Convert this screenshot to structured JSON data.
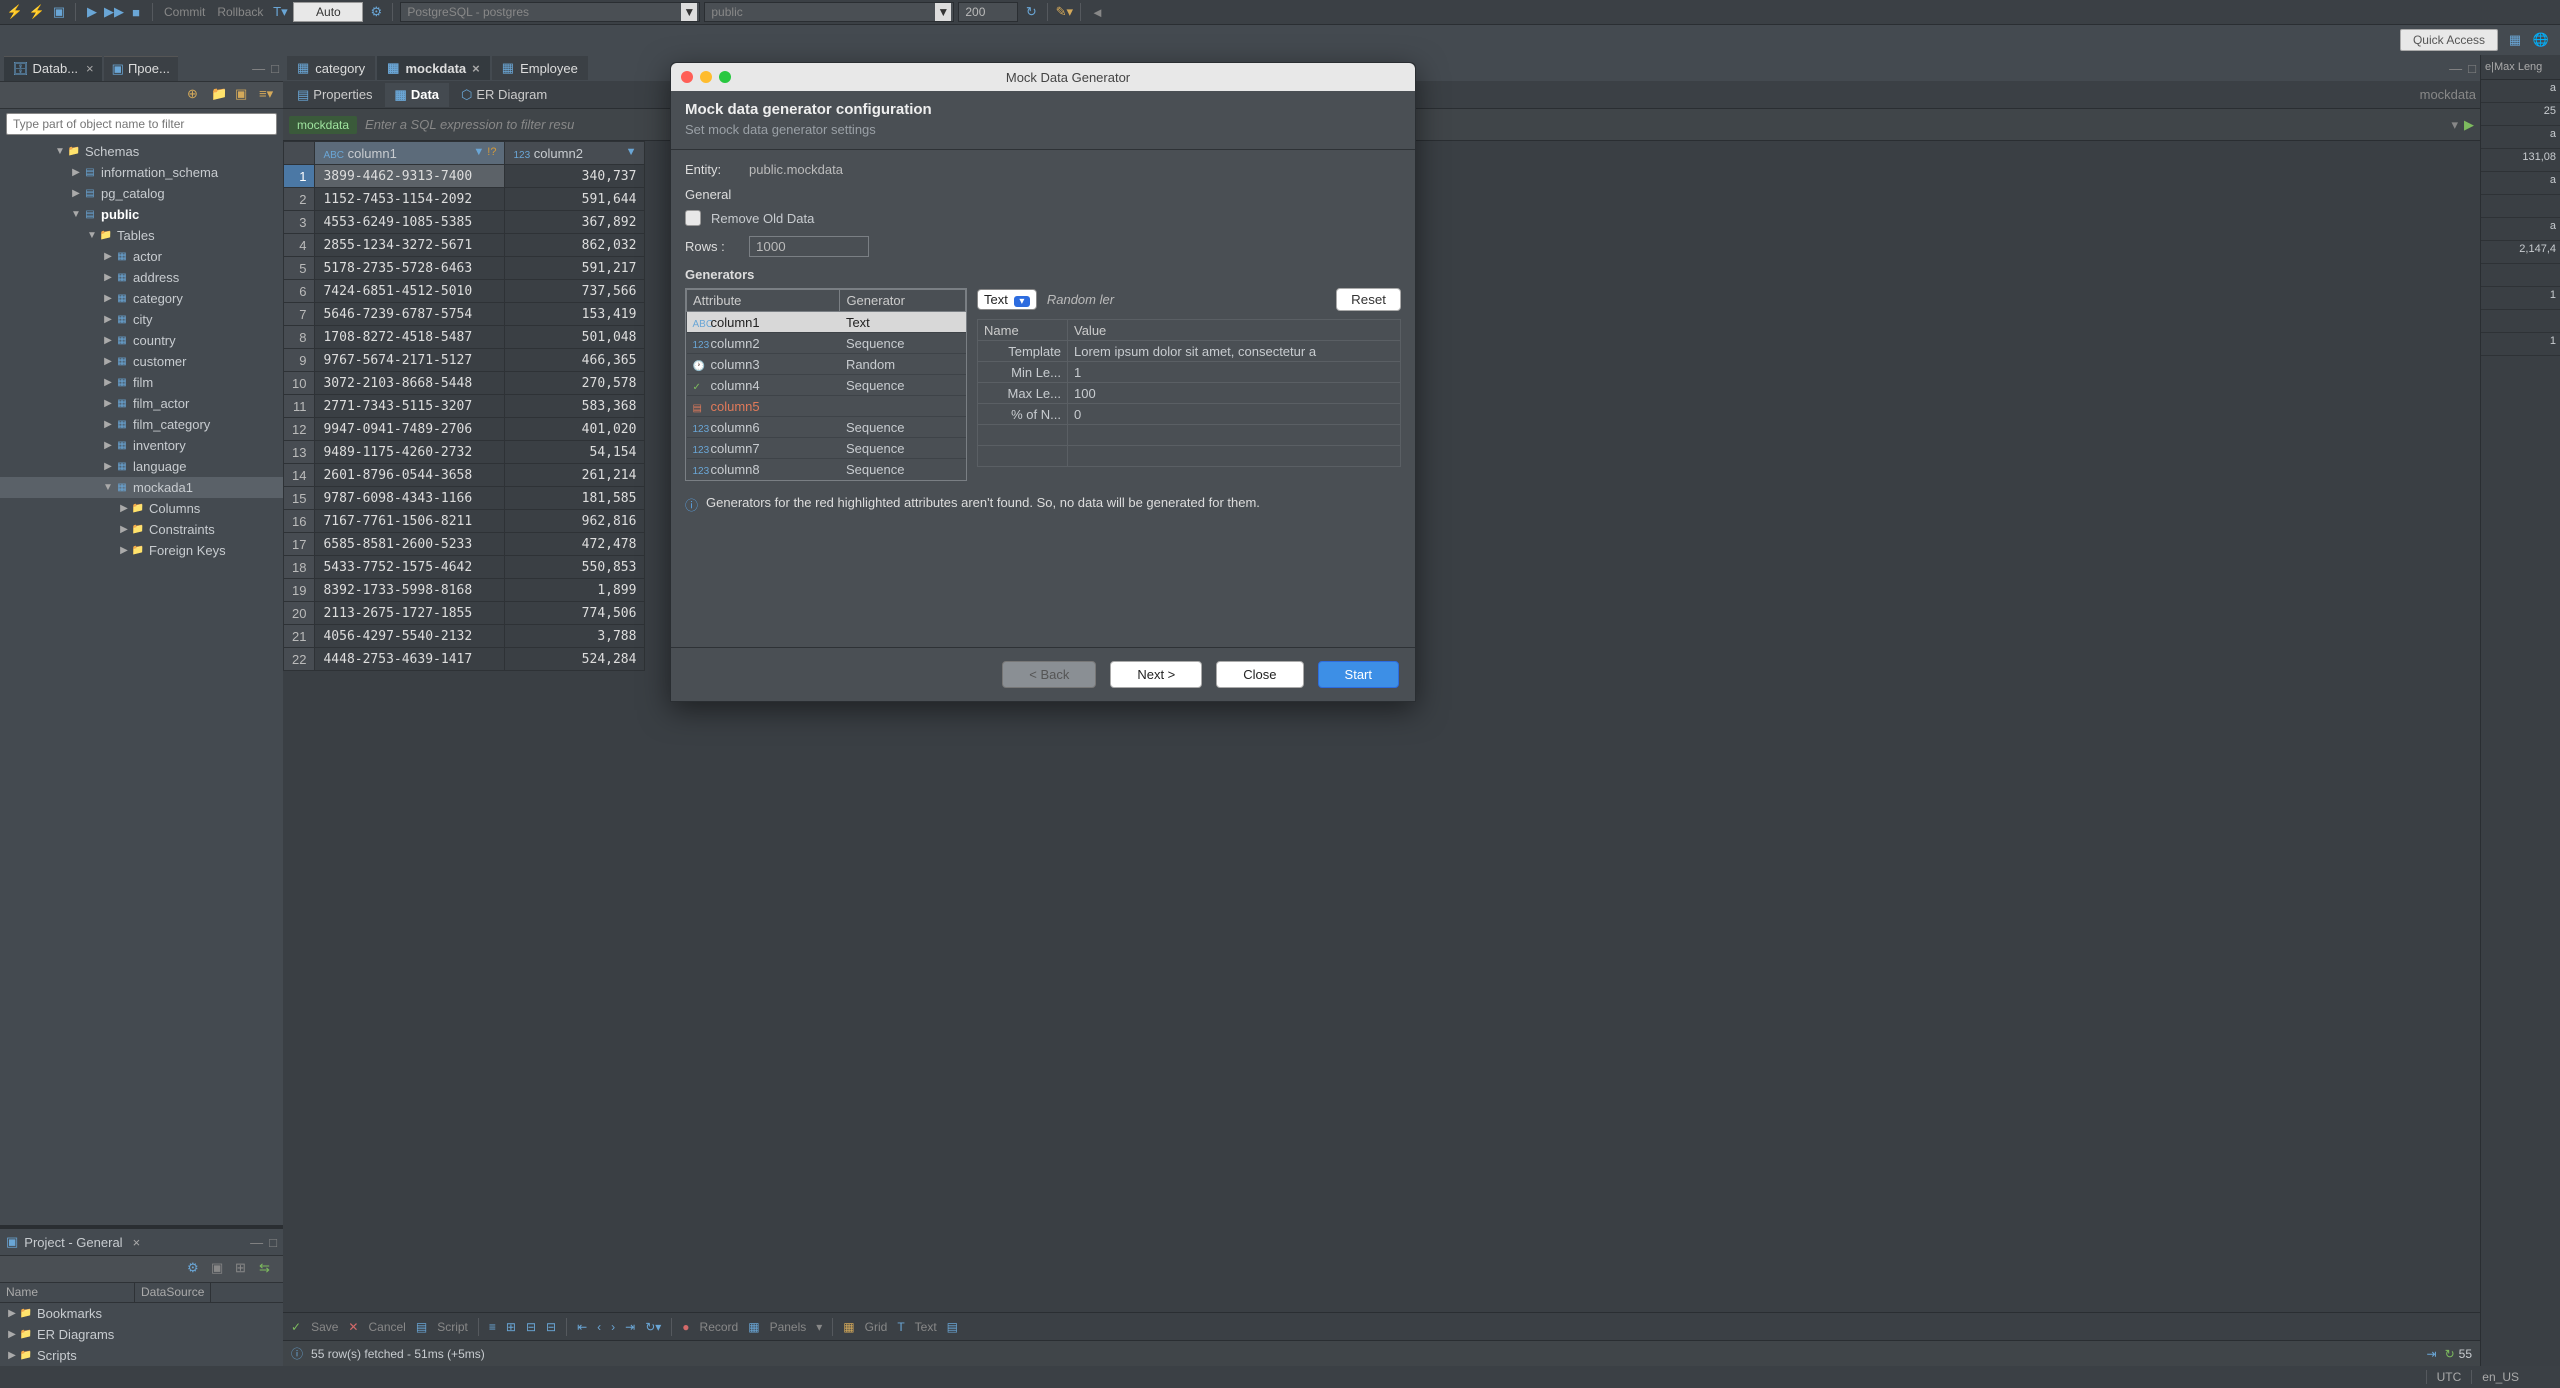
{
  "toolbar": {
    "commit": "Commit",
    "rollback": "Rollback",
    "mode": "Auto",
    "conn": "PostgreSQL - postgres",
    "schema": "public",
    "rows_limit": "200"
  },
  "quick_access": "Quick Access",
  "left_tabs": {
    "t1": "Datab...",
    "t2": "Прое..."
  },
  "filter_placeholder": "Type part of object name to filter",
  "tree": {
    "schemas": "Schemas",
    "info_schema": "information_schema",
    "pg_catalog": "pg_catalog",
    "public": "public",
    "tables": "Tables",
    "tables_list": [
      "actor",
      "address",
      "category",
      "city",
      "country",
      "customer",
      "film",
      "film_actor",
      "film_category",
      "inventory",
      "language",
      "mockada1"
    ],
    "mock_children": [
      "Columns",
      "Constraints",
      "Foreign Keys"
    ]
  },
  "project": {
    "title": "Project - General",
    "col_name": "Name",
    "col_ds": "DataSource",
    "items": [
      "Bookmarks",
      "ER Diagrams",
      "Scripts"
    ]
  },
  "editor_tabs": {
    "t1": "category",
    "t2": "mockdata",
    "t3": "Employee"
  },
  "subtabs": {
    "p": "Properties",
    "d": "Data",
    "e": "ER Diagram"
  },
  "filter_chip": "mockdata",
  "filter_hint": "Enter a SQL expression to filter resu",
  "cols": {
    "c1": "column1",
    "c2": "column2"
  },
  "rows": [
    [
      "3899-4462-9313-7400",
      "340,737"
    ],
    [
      "1152-7453-1154-2092",
      "591,644"
    ],
    [
      "4553-6249-1085-5385",
      "367,892"
    ],
    [
      "2855-1234-3272-5671",
      "862,032"
    ],
    [
      "5178-2735-5728-6463",
      "591,217"
    ],
    [
      "7424-6851-4512-5010",
      "737,566"
    ],
    [
      "5646-7239-6787-5754",
      "153,419"
    ],
    [
      "1708-8272-4518-5487",
      "501,048"
    ],
    [
      "9767-5674-2171-5127",
      "466,365"
    ],
    [
      "3072-2103-8668-5448",
      "270,578"
    ],
    [
      "2771-7343-5115-3207",
      "583,368"
    ],
    [
      "9947-0941-7489-2706",
      "401,020"
    ],
    [
      "9489-1175-4260-2732",
      "54,154"
    ],
    [
      "2601-8796-0544-3658",
      "261,214"
    ],
    [
      "9787-6098-4343-1166",
      "181,585"
    ],
    [
      "7167-7761-1506-8211",
      "962,816"
    ],
    [
      "6585-8581-2600-5233",
      "472,478"
    ],
    [
      "5433-7752-1575-4642",
      "550,853"
    ],
    [
      "8392-1733-5998-8168",
      "1,899"
    ],
    [
      "2113-2675-1727-1855",
      "774,506"
    ],
    [
      "4056-4297-5540-2132",
      "3,788"
    ],
    [
      "4448-2753-4639-1417",
      "524,284"
    ]
  ],
  "bottom": {
    "save": "Save",
    "cancel": "Cancel",
    "script": "Script",
    "record": "Record",
    "panels": "Panels",
    "grid": "Grid",
    "text": "Text"
  },
  "status": {
    "msg": "55 row(s) fetched - 51ms (+5ms)",
    "count": "55"
  },
  "right": {
    "h1": "e",
    "h2": "Max Leng",
    "vals": [
      "a",
      "25",
      "a",
      "131,08",
      "a",
      "",
      "a",
      "2,147,4",
      "",
      "1",
      "",
      "1"
    ]
  },
  "modal": {
    "title": "Mock Data Generator",
    "h": "Mock data generator configuration",
    "sub": "Set mock data generator settings",
    "entity_l": "Entity:",
    "entity_v": "public.mockdata",
    "general": "General",
    "remove_old": "Remove Old Data",
    "rows_l": "Rows :",
    "rows_v": "1000",
    "generators": "Generators",
    "attr_h": "Attribute",
    "gen_h": "Generator",
    "attrs": [
      {
        "name": "column1",
        "gen": "Text",
        "ico": "ABC",
        "sel": true
      },
      {
        "name": "column2",
        "gen": "Sequence",
        "ico": "123"
      },
      {
        "name": "column3",
        "gen": "Random",
        "ico": "clock"
      },
      {
        "name": "column4",
        "gen": "Sequence",
        "ico": "check"
      },
      {
        "name": "column5",
        "gen": "",
        "ico": "doc",
        "red": true
      },
      {
        "name": "column6",
        "gen": "Sequence",
        "ico": "123"
      },
      {
        "name": "column7",
        "gen": "Sequence",
        "ico": "123"
      },
      {
        "name": "column8",
        "gen": "Sequence",
        "ico": "123"
      }
    ],
    "type_sel": "Text",
    "desc": "Random ler",
    "reset": "Reset",
    "name_h": "Name",
    "value_h": "Value",
    "props": [
      {
        "n": "Template",
        "v": "Lorem ipsum dolor sit amet, consectetur a"
      },
      {
        "n": "Min Le...",
        "v": "1"
      },
      {
        "n": "Max Le...",
        "v": "100"
      },
      {
        "n": "% of N...",
        "v": "0"
      }
    ],
    "info": "Generators for the red highlighted attributes aren't found. So, no data will be generated for them.",
    "back": "< Back",
    "next": "Next >",
    "close": "Close",
    "start": "Start"
  },
  "app_status": {
    "tz": "UTC",
    "loc": "en_US"
  },
  "editor_name": "mockdata"
}
